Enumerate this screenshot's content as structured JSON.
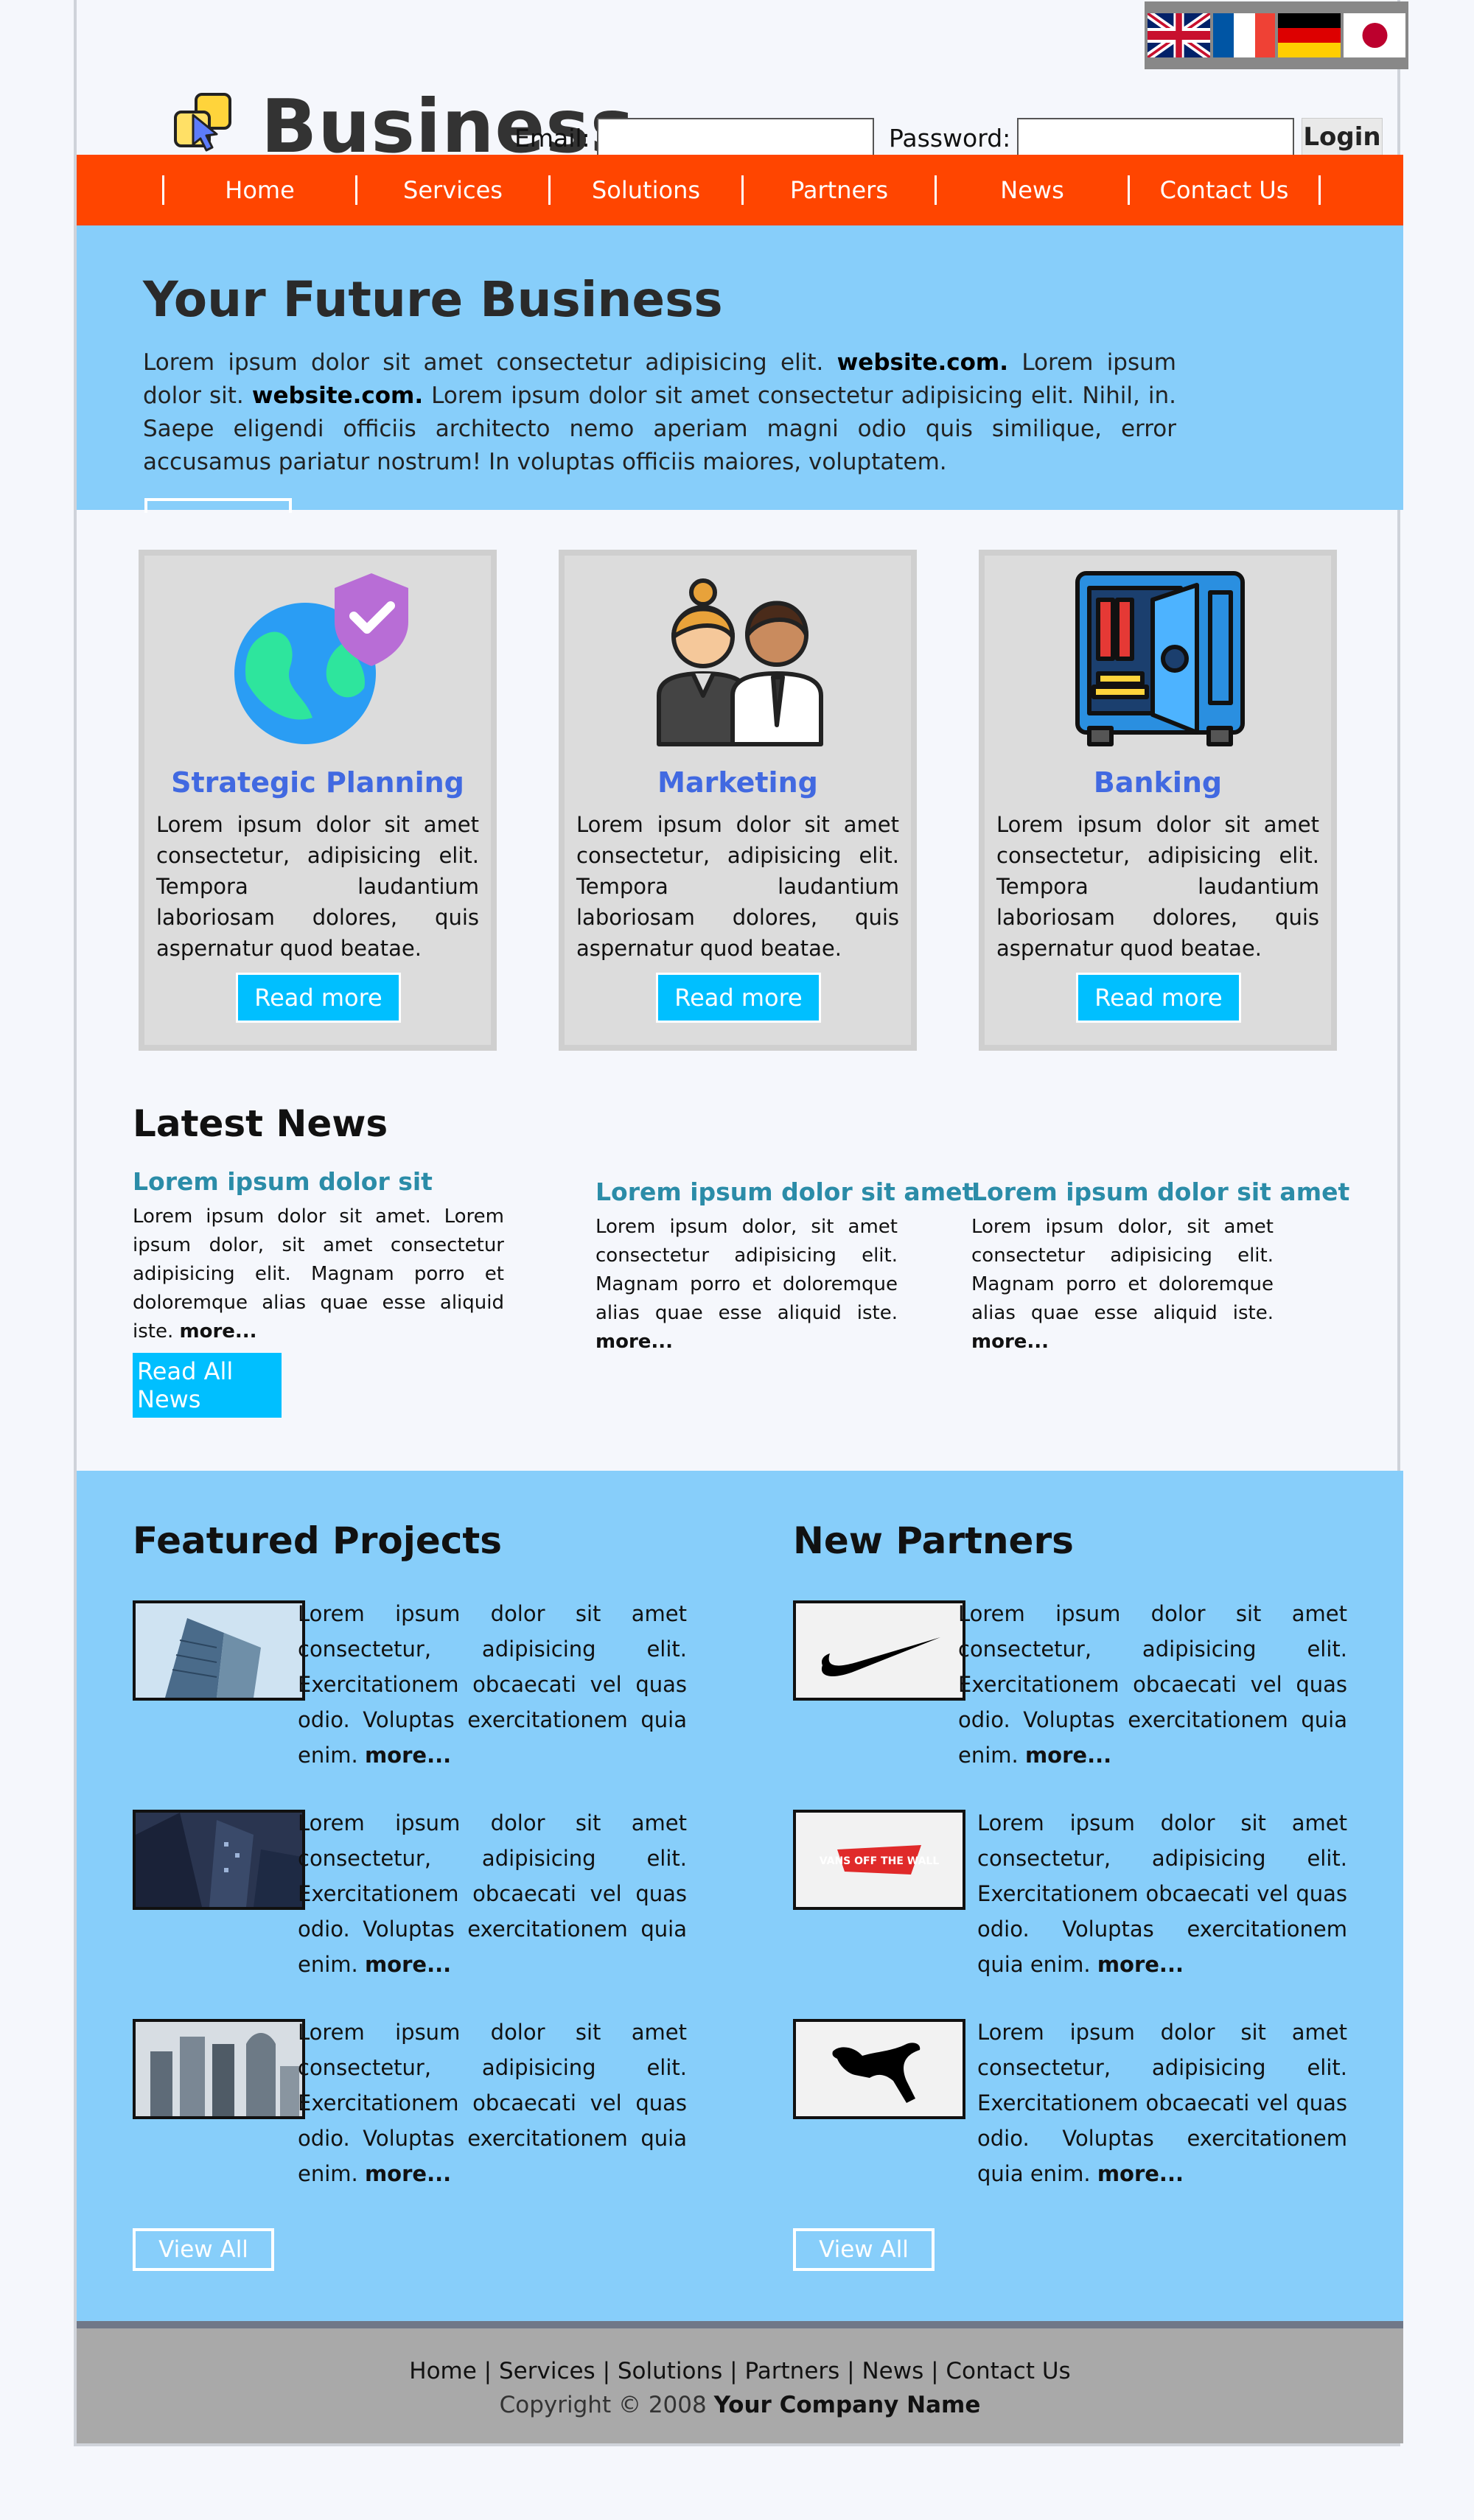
{
  "header": {
    "brand": "Business",
    "email_label": "Email:",
    "password_label": "Password:",
    "login_label": "Login",
    "languages": [
      "English",
      "French",
      "German",
      "Japanese"
    ]
  },
  "nav": {
    "items": [
      "Home",
      "Services",
      "Solutions",
      "Partners",
      "News",
      "Contact Us"
    ]
  },
  "hero": {
    "title": "Your Future Business",
    "text_1": "Lorem ipsum dolor sit amet consectetur adipisicing elit. ",
    "bold_1": "website.com.",
    "text_2": " Lorem ipsum dolor sit. ",
    "bold_2": "website.com.",
    "text_3": " Lorem ipsum dolor sit amet consectetur adipisicing elit. Nihil, in. Saepe eligendi officiis architecto nemo aperiam magni odio quis similique, error accusamus pariatur nostrum! In voluptas officiis maiores, voluptatem."
  },
  "cards": [
    {
      "icon": "globe-shield-icon",
      "title": "Strategic Planning",
      "text": "Lorem ipsum dolor sit amet consectetur, adipisicing elit. Tempora laudantium laboriosam dolores, quis aspernatur quod beatae.",
      "button": "Read more"
    },
    {
      "icon": "team-people-icon",
      "title": "Marketing",
      "text": "Lorem ipsum dolor sit amet consectetur, adipisicing elit. Tempora laudantium laboriosam dolores, quis aspernatur quod beatae.",
      "button": "Read more"
    },
    {
      "icon": "safe-vault-icon",
      "title": "Banking",
      "text": "Lorem ipsum dolor sit amet consectetur, adipisicing elit. Tempora laudantium laboriosam dolores, quis aspernatur quod beatae.",
      "button": "Read more"
    }
  ],
  "news": {
    "heading": "Latest News",
    "read_all": "Read All News",
    "more": "more...",
    "items": [
      {
        "title": "Lorem ipsum dolor sit",
        "text": "Lorem ipsum dolor sit amet. Lorem ipsum dolor, sit amet consectetur adipisicing elit. Magnam porro et doloremque alias quae esse aliquid iste."
      },
      {
        "title": "Lorem ipsum dolor sit amet",
        "text": "Lorem ipsum dolor, sit amet consectetur adipisicing elit. Magnam porro et doloremque alias quae esse aliquid iste."
      },
      {
        "title": "Lorem ipsum dolor sit amet",
        "text": "Lorem ipsum dolor, sit amet consectetur adipisicing elit. Magnam porro et doloremque alias quae esse aliquid iste."
      }
    ]
  },
  "featured": {
    "heading": "Featured Projects",
    "view_all": "View All",
    "text": "Lorem ipsum dolor sit amet consectetur, adipisicing elit. Exercitationem obcaecati vel quas odio. Voluptas exercitationem quia enim.",
    "more": "more..."
  },
  "partners": {
    "heading": "New Partners",
    "view_all": "View All",
    "text": "Lorem ipsum dolor sit amet consectetur, adipisicing elit. Exercitationem obcaecati vel quas odio. Voluptas exercitationem quia enim.",
    "more": "more...",
    "logos": [
      "nike-logo",
      "vans-logo",
      "puma-logo"
    ],
    "vans_text": "VANS OFF THE WALL"
  },
  "footer": {
    "links": [
      "Home",
      "Services",
      "Solutions",
      "Partners",
      "News",
      "Contact Us"
    ],
    "separator": " | ",
    "copyright": "Copyright © 2008 ",
    "company": "Your Company Name"
  },
  "colors": {
    "nav": "#ff4500",
    "hero": "#87cefa",
    "accent_button": "#00bfff",
    "card_title": "#4169e1",
    "news_title": "#2b8ca8",
    "footer": "#a9a9a9"
  }
}
